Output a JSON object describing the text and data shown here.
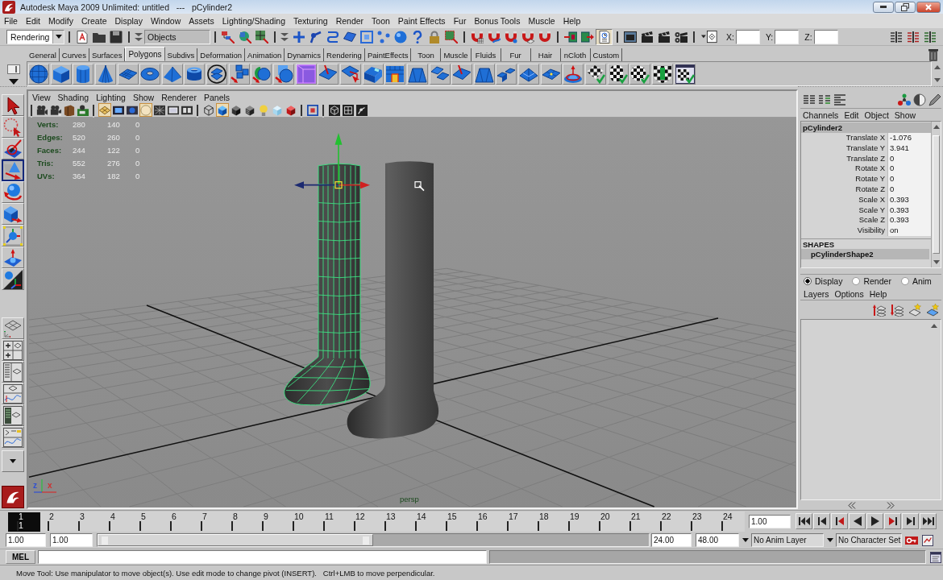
{
  "window": {
    "title": "Autodesk Maya 2009 Unlimited: untitled   ---   pCylinder2"
  },
  "menu_bar": [
    "File",
    "Edit",
    "Modify",
    "Create",
    "Display",
    "Window",
    "Assets",
    "Lighting/Shading",
    "Texturing",
    "Render",
    "Toon",
    "Paint Effects",
    "Fur",
    "Bonus Tools",
    "Muscle",
    "Help"
  ],
  "status_line": {
    "menu_set": "Rendering",
    "selection_mode": "Objects",
    "history": {
      "on": true
    },
    "fields": [
      {
        "label": "X:"
      },
      {
        "label": "Y:"
      },
      {
        "label": "Z:"
      }
    ]
  },
  "shelf": {
    "tabs": [
      {
        "label": "General",
        "selected": false
      },
      {
        "label": "Curves",
        "selected": false
      },
      {
        "label": "Surfaces",
        "selected": false
      },
      {
        "label": "Polygons",
        "selected": true
      },
      {
        "label": "Subdivs",
        "selected": false
      },
      {
        "label": "Deformation",
        "selected": false
      },
      {
        "label": "Animation",
        "selected": false
      },
      {
        "label": "Dynamics",
        "selected": false
      },
      {
        "label": "Rendering",
        "selected": false
      },
      {
        "label": "PaintEffects",
        "selected": false
      },
      {
        "label": "Toon",
        "selected": false
      },
      {
        "label": "Muscle",
        "selected": false
      },
      {
        "label": "Fluids",
        "selected": false
      },
      {
        "label": "Fur",
        "selected": false
      },
      {
        "label": "Hair",
        "selected": false
      },
      {
        "label": "nCloth",
        "selected": false
      },
      {
        "label": "Custom",
        "selected": false
      }
    ]
  },
  "toolbox": {
    "tools": [
      {
        "selected": false
      },
      {
        "selected": false
      },
      {
        "selected": false
      },
      {
        "selected": true
      },
      {
        "selected": false
      },
      {
        "selected": false
      },
      {
        "selected": false
      },
      {
        "selected": false
      },
      {
        "selected": false
      }
    ]
  },
  "viewport": {
    "menu": [
      "View",
      "Shading",
      "Lighting",
      "Show",
      "Renderer",
      "Panels"
    ],
    "toolbar": [
      {
        "on": false
      },
      {
        "on": false
      },
      {
        "on": false
      },
      {
        "on": false
      },
      {
        "on": true
      },
      {
        "on": false
      },
      {
        "on": false
      },
      {
        "on": true
      },
      {
        "on": false
      },
      {
        "on": false
      },
      {
        "on": false
      },
      {
        "on": false
      },
      {
        "on": true
      },
      {
        "on": false
      },
      {
        "on": false
      },
      {
        "on": false
      },
      {
        "on": false
      },
      {
        "on": false
      },
      {
        "on": false
      },
      {
        "on": false
      },
      {
        "on": false
      },
      {
        "on": false
      }
    ],
    "hud": [
      {
        "label": "Verts:",
        "values": [
          "280",
          "140",
          "0"
        ]
      },
      {
        "label": "Edges:",
        "values": [
          "520",
          "260",
          "0"
        ]
      },
      {
        "label": "Faces:",
        "values": [
          "244",
          "122",
          "0"
        ]
      },
      {
        "label": "Tris:",
        "values": [
          "552",
          "276",
          "0"
        ]
      },
      {
        "label": "UVs:",
        "values": [
          "364",
          "182",
          "0"
        ]
      }
    ],
    "camera": "persp",
    "axes": [
      {
        "label": "z",
        "color": "#3050d0"
      },
      {
        "label": "x",
        "color": "#d03030"
      }
    ]
  },
  "channel_box": {
    "menu": [
      "Channels",
      "Edit",
      "Object",
      "Show"
    ],
    "object": "pCylinder2",
    "attributes": [
      {
        "name": "Translate X",
        "value": "-1.076"
      },
      {
        "name": "Translate Y",
        "value": "3.941"
      },
      {
        "name": "Translate Z",
        "value": "0"
      },
      {
        "name": "Rotate X",
        "value": "0"
      },
      {
        "name": "Rotate Y",
        "value": "0"
      },
      {
        "name": "Rotate Z",
        "value": "0"
      },
      {
        "name": "Scale X",
        "value": "0.393"
      },
      {
        "name": "Scale Y",
        "value": "0.393"
      },
      {
        "name": "Scale Z",
        "value": "0.393"
      },
      {
        "name": "Visibility",
        "value": "on"
      }
    ],
    "shapes_heading": "SHAPES",
    "shape": "pCylinderShape2"
  },
  "layer_editor": {
    "modes": [
      {
        "label": "Display",
        "selected": true
      },
      {
        "label": "Render",
        "selected": false
      },
      {
        "label": "Anim",
        "selected": false
      }
    ],
    "menu": [
      "Layers",
      "Options",
      "Help"
    ]
  },
  "time_slider": {
    "frames": [
      {
        "label": "1",
        "selected": true
      },
      {
        "label": "2",
        "selected": false
      },
      {
        "label": "3",
        "selected": false
      },
      {
        "label": "4",
        "selected": false
      },
      {
        "label": "5",
        "selected": false
      },
      {
        "label": "6",
        "selected": false
      },
      {
        "label": "7",
        "selected": false
      },
      {
        "label": "8",
        "selected": false
      },
      {
        "label": "9",
        "selected": false
      },
      {
        "label": "10",
        "selected": false
      },
      {
        "label": "11",
        "selected": false
      },
      {
        "label": "12",
        "selected": false
      },
      {
        "label": "13",
        "selected": false
      },
      {
        "label": "14",
        "selected": false
      },
      {
        "label": "15",
        "selected": false
      },
      {
        "label": "16",
        "selected": false
      },
      {
        "label": "17",
        "selected": false
      },
      {
        "label": "18",
        "selected": false
      },
      {
        "label": "19",
        "selected": false
      },
      {
        "label": "20",
        "selected": false
      },
      {
        "label": "21",
        "selected": false
      },
      {
        "label": "22",
        "selected": false
      },
      {
        "label": "23",
        "selected": false
      },
      {
        "label": "24",
        "selected": false
      }
    ],
    "current_frame": "1",
    "current_time": "1.00"
  },
  "range_slider": {
    "start_time": "1.00",
    "range_start": "1.00",
    "level": 0.5,
    "range_end": "24.00",
    "end_time": "48.00",
    "anim_layer": "No Anim Layer",
    "character_set": "No Character Set"
  },
  "command_line": {
    "language": "MEL"
  },
  "help_line": "Move Tool: Use manipulator to move object(s). Use edit mode to change pivot (INSERT).   Ctrl+LMB to move perpendicular."
}
